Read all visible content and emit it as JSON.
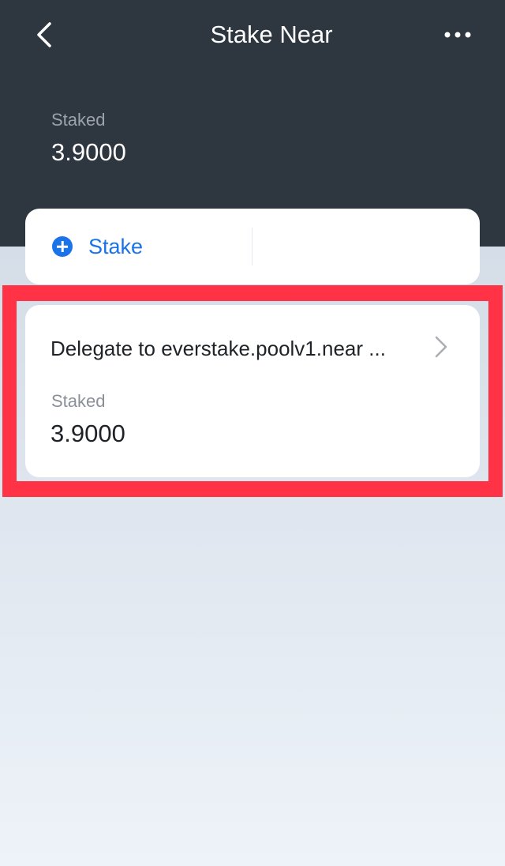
{
  "nav": {
    "title": "Stake Near",
    "back_icon": "chevron-left-icon",
    "more_icon": "more-horizontal-icon"
  },
  "summary": {
    "label": "Staked",
    "value": "3.9000"
  },
  "actions": {
    "stake_label": "Stake",
    "stake_icon": "plus-circle-icon"
  },
  "delegations": [
    {
      "title": "Delegate to everstake.poolv1.near ...",
      "label": "Staked",
      "value": "3.9000"
    }
  ],
  "colors": {
    "header_bg": "#2e3640",
    "accent": "#1a73e8",
    "highlight": "#ff3246"
  }
}
